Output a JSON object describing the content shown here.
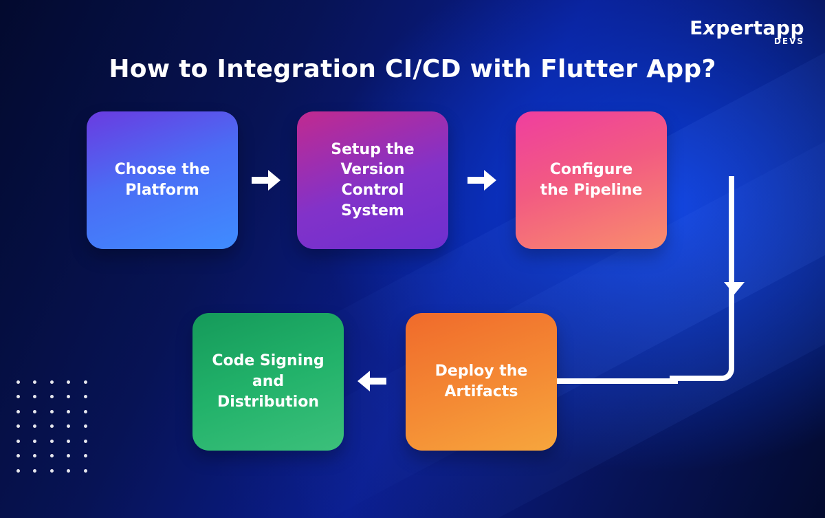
{
  "brand": {
    "main": "Expert",
    "suffix": "app",
    "sub": "DEVS"
  },
  "title": "How to Integration CI/CD with Flutter App?",
  "steps": {
    "s1": "Choose the Platform",
    "s2": "Setup the Version Control System",
    "s3": "Configure the Pipeline",
    "s4": "Deploy the Artifacts",
    "s5": "Code Signing and Distribution"
  }
}
